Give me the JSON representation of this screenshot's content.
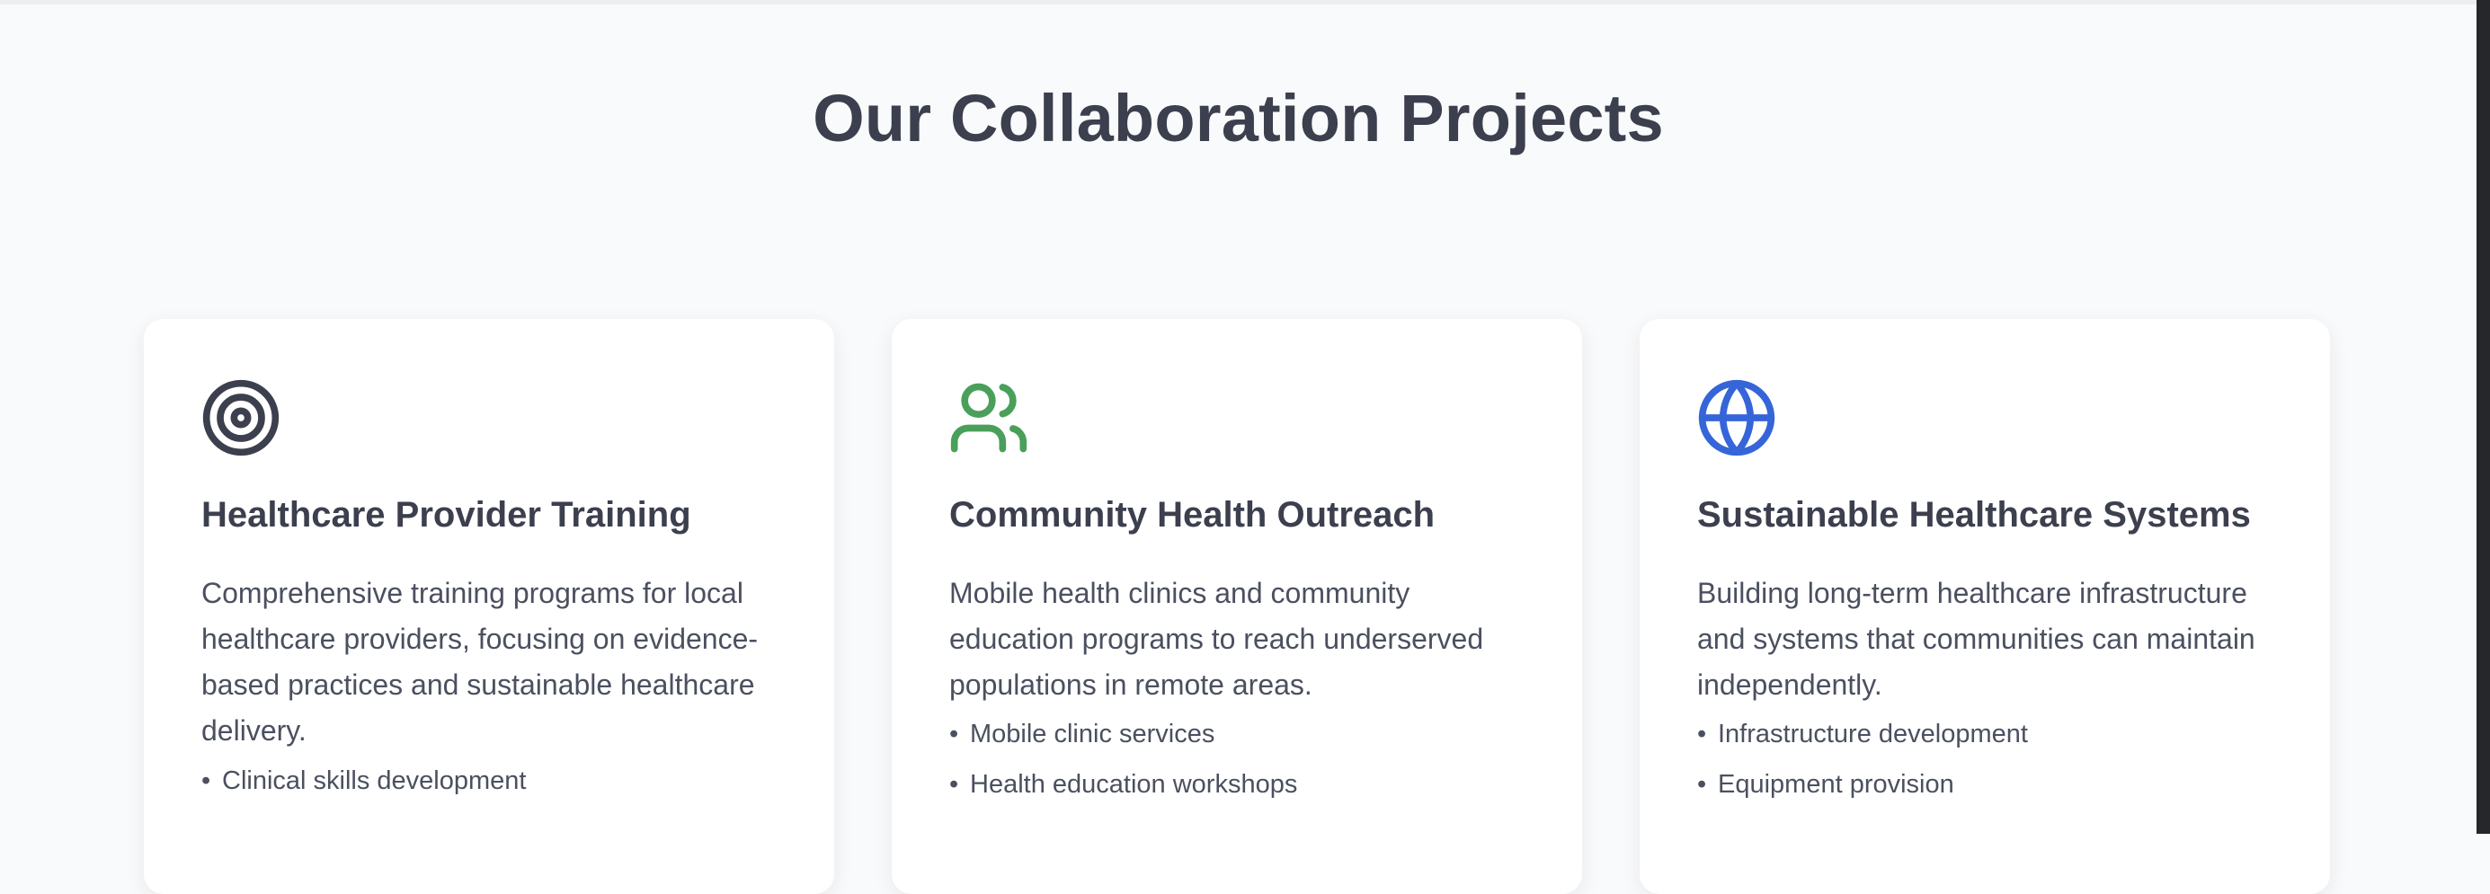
{
  "section": {
    "title": "Our Collaboration Projects"
  },
  "projects": [
    {
      "icon": "target-icon",
      "icon_color": "#3c3f4d",
      "title": "Healthcare Provider Training",
      "description": "Comprehensive training programs for local healthcare providers, focusing on evidence-based practices and sustainable healthcare delivery.",
      "features": [
        "Clinical skills development"
      ]
    },
    {
      "icon": "users-icon",
      "icon_color": "#4aa05a",
      "title": "Community Health Outreach",
      "description": "Mobile health clinics and community education programs to reach underserved populations in remote areas.",
      "features": [
        "Mobile clinic services",
        "Health education workshops"
      ]
    },
    {
      "icon": "globe-icon",
      "icon_color": "#3565d8",
      "title": "Sustainable Healthcare Systems",
      "description": "Building long-term healthcare infrastructure and systems that communities can maintain independently.",
      "features": [
        "Infrastructure development",
        "Equipment provision"
      ]
    }
  ],
  "bullet_char": "•"
}
